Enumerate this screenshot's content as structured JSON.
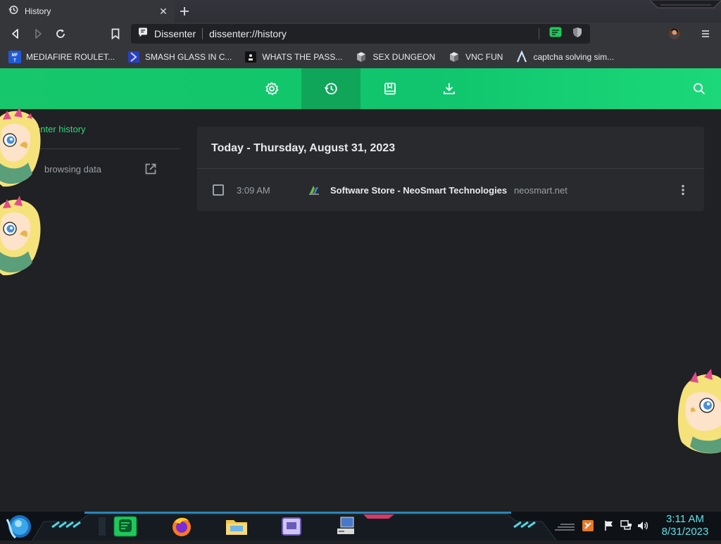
{
  "tab": {
    "title": "History",
    "close": "✕"
  },
  "toolbar": {
    "site_name": "Dissenter",
    "url": "dissenter://history"
  },
  "bookmarks": [
    {
      "label": "MEDIAFIRE ROULET...",
      "icon": "mediafire-icon",
      "badge": "MF"
    },
    {
      "label": "SMASH GLASS IN C...",
      "icon": "chevron-bookmark-icon"
    },
    {
      "label": "WHATS THE PASS...",
      "icon": "dark-square-icon"
    },
    {
      "label": "SEX DUNGEON",
      "icon": "server-icon"
    },
    {
      "label": "VNC FUN",
      "icon": "server-icon"
    },
    {
      "label": "captcha solving sim...",
      "icon": "lambda-icon"
    }
  ],
  "nav": {
    "items": [
      {
        "name": "settings",
        "icon": "gear-icon"
      },
      {
        "name": "history",
        "icon": "history-icon",
        "active": true
      },
      {
        "name": "bookmarks",
        "icon": "bookmark-book-icon"
      },
      {
        "name": "downloads",
        "icon": "download-icon"
      }
    ]
  },
  "sidebar": {
    "title": "enter history",
    "clear_label": "browsing data"
  },
  "history": {
    "group_title": "Today - Thursday, August 31, 2023",
    "entries": [
      {
        "time": "3:09 AM",
        "title": "Software Store - NeoSmart Technologies",
        "domain": "neosmart.net"
      }
    ]
  },
  "taskbar": {
    "time": "3:11 AM",
    "date": "8/31/2023"
  },
  "colors": {
    "accent": "#1ec85a",
    "active_nav": "#0fa65a",
    "background": "#202124",
    "card": "#292a2d",
    "clock": "#5fe0e8"
  }
}
